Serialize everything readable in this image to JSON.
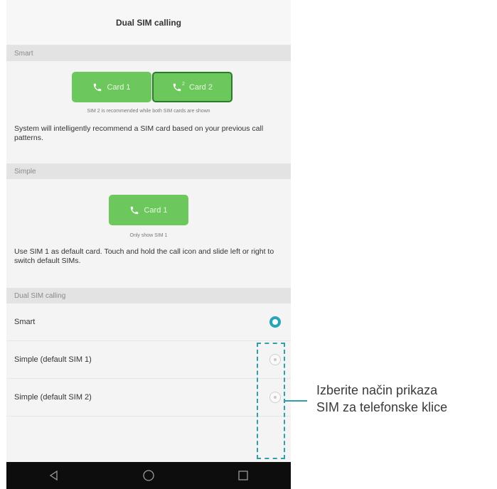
{
  "header": {
    "title": "Dual SIM calling"
  },
  "smart_section": {
    "header": "Smart",
    "buttons": [
      "Card 1",
      "Card 2"
    ],
    "card2_superscript": "2",
    "hint": "SIM 2 is recommended while both SIM cards are shown",
    "description": "System will intelligently recommend a SIM card based on your previous call patterns."
  },
  "simple_section": {
    "header": "Simple",
    "button": "Card 1",
    "hint": "Only show SIM 1",
    "description": "Use SIM 1 as default card. Touch and hold the call icon and slide left or right to switch default SIMs."
  },
  "mode_section": {
    "header": "Dual SIM calling",
    "options": [
      {
        "label": "Smart",
        "selected": true
      },
      {
        "label": "Simple (default SIM 1)",
        "selected": false
      },
      {
        "label": "Simple (default SIM 2)",
        "selected": false
      }
    ]
  },
  "navbar": {
    "icons": [
      "back-icon",
      "home-icon",
      "recents-icon"
    ]
  },
  "annotation": {
    "line1": "Izberite način prikaza",
    "line2": "SIM za telefonske klice",
    "color": "#2f9fa9"
  },
  "colors": {
    "accent_green": "#6cc75c",
    "radio_active": "#25a5b7"
  }
}
